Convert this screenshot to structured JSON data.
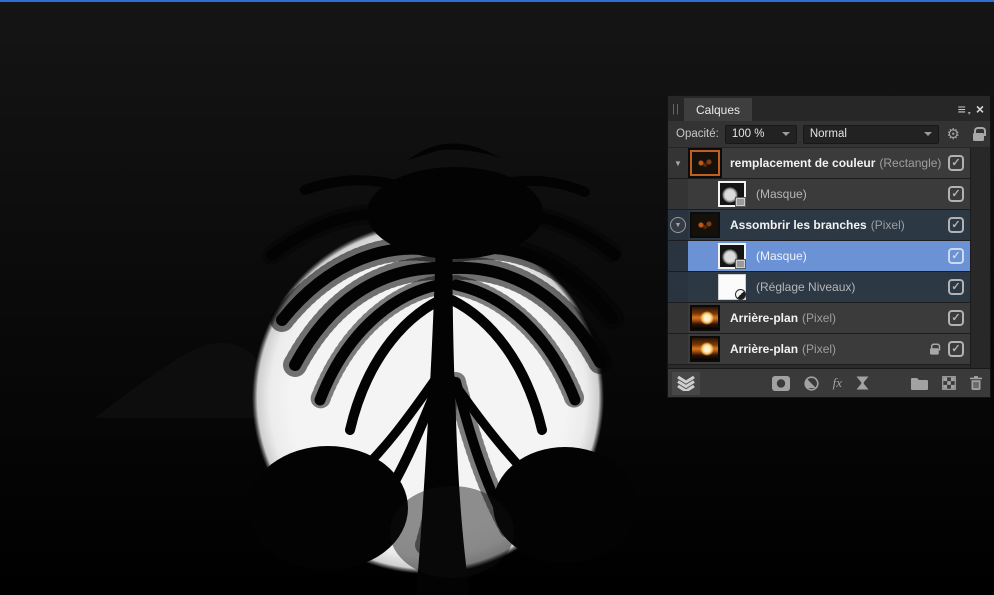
{
  "window": {
    "top_accent_color": "#2e6fd6"
  },
  "panel": {
    "title_tab": "Calques",
    "grip_glyph": "||",
    "menu_icon_glyph": "≡",
    "close_icon_glyph": "×",
    "controls": {
      "opacity_label": "Opacité:",
      "opacity_value": "100 %",
      "blend_mode_value": "Normal"
    },
    "rows": [
      {
        "name": "remplacement de couleur",
        "suffix": "(Rectangle)"
      },
      {
        "name": "(Masque)",
        "suffix": ""
      },
      {
        "name": "Assombrir les branches",
        "suffix": "(Pixel)"
      },
      {
        "name": "(Masque)",
        "suffix": ""
      },
      {
        "name": "(Réglage Niveaux)",
        "suffix": ""
      },
      {
        "name": "Arrière-plan",
        "suffix": "(Pixel)"
      },
      {
        "name": "Arrière-plan",
        "suffix": "(Pixel)"
      }
    ],
    "toolbar": {
      "fx_label": "fx"
    }
  },
  "glyphs": {
    "expand_triangle": "▼",
    "check": "✓",
    "gear": "⚙",
    "dropdown_caret": "▾"
  },
  "colors": {
    "selected_row": "#6a92d4",
    "group_row": "#2d3845",
    "row": "#3b3b3b",
    "panel": "#323232",
    "thumb_selection_border": "#c06020"
  }
}
